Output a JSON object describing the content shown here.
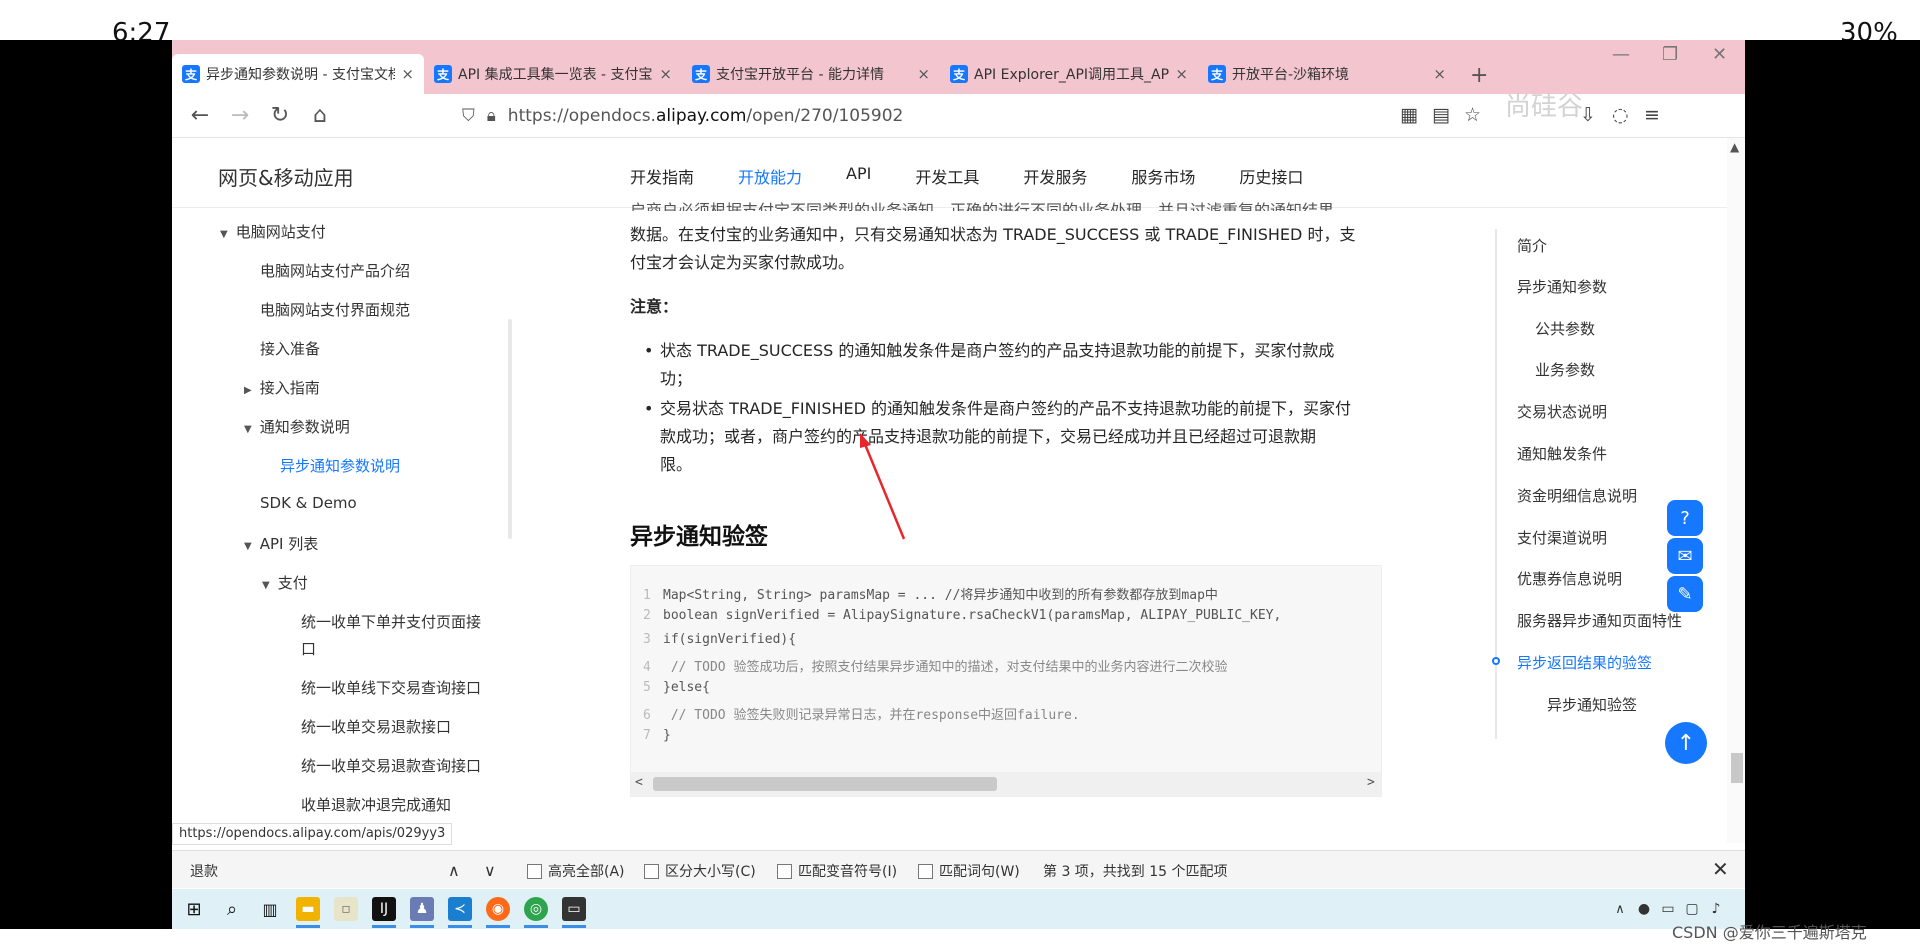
{
  "phone_status": {
    "time": "6:27",
    "battery": "30%"
  },
  "tabs": [
    {
      "label": "异步通知参数说明 - 支付宝文档",
      "close": "×",
      "active": true
    },
    {
      "label": "API 集成工具集一览表 - 支付宝",
      "close": "×",
      "active": false
    },
    {
      "label": "支付宝开放平台 - 能力详情",
      "close": "×",
      "active": false
    },
    {
      "label": "API Explorer_API调用工具_API",
      "close": "×",
      "active": false
    },
    {
      "label": "开放平台-沙箱环境",
      "close": "×",
      "active": false
    }
  ],
  "new_tab": "+",
  "address": {
    "prefix": "https://opendocs.",
    "domain": "alipay.com",
    "path": "/open/270/105902"
  },
  "site": {
    "title": "网页&移动应用",
    "nav": [
      "开发指南",
      "开放能力",
      "API",
      "开发工具",
      "开发服务",
      "服务市场",
      "历史接口"
    ],
    "nav_active": 1
  },
  "sidebar": {
    "items": [
      {
        "label": "电脑网站支付",
        "caret": "▼"
      },
      {
        "label": "电脑网站支付产品介绍"
      },
      {
        "label": "电脑网站支付界面规范"
      },
      {
        "label": "接入准备"
      },
      {
        "label": "接入指南",
        "caret": "▶"
      },
      {
        "label": "通知参数说明",
        "caret": "▼"
      },
      {
        "label": "异步通知参数说明",
        "active": true
      },
      {
        "label": "SDK & Demo"
      },
      {
        "label": "API 列表",
        "caret": "▼"
      },
      {
        "label": "支付",
        "caret": "▼"
      },
      {
        "label": "统一收单下单并支付页面接"
      },
      {
        "label": "口"
      },
      {
        "label": "统一收单线下交易查询接口"
      },
      {
        "label": "统一收单交易退款接口"
      },
      {
        "label": "统一收单交易退款查询接口"
      },
      {
        "label": "收单退款冲退完成通知"
      }
    ]
  },
  "content": {
    "intro_line0": "启商户必须根据支付宝不同类型的业务通知，正确的进行不同的业务处理，并且过滤重复的通知结果",
    "intro_line1": "数据。在支付宝的业务通知中，只有交易通知状态为 TRADE_SUCCESS 或 TRADE_FINISHED 时，支",
    "intro_line2": "付宝才会认定为买家付款成功。",
    "note_title": "注意：",
    "bullet1_line1": "状态 TRADE_SUCCESS 的通知触发条件是商户签约的产品支持退款功能的前提下，买家付款成",
    "bullet1_line2": "功；",
    "bullet2_line1": "交易状态 TRADE_FINISHED 的通知触发条件是商户签约的产品不支持退款功能的前提下，买家付",
    "bullet2_line2": "款成功；或者，商户签约的产品支持退款功能的前提下，交易已经成功并且已经超过可退款期",
    "bullet2_line3": "限。",
    "section_title": "异步通知验签",
    "code": [
      {
        "n": "1",
        "text": "Map<String, String> paramsMap = ... //将异步通知中收到的所有参数都存放到map中"
      },
      {
        "n": "2",
        "text": "boolean signVerified = AlipaySignature.rsaCheckV1(paramsMap, ALIPAY_PUBLIC_KEY,"
      },
      {
        "n": "3",
        "text": "if(signVerified){"
      },
      {
        "n": "4",
        "text": "    // TODO 验签成功后，按照支付结果异步通知中的描述，对支付结果中的业务内容进行二次校验"
      },
      {
        "n": "5",
        "text": "}else{"
      },
      {
        "n": "6",
        "text": "    // TODO 验签失败则记录异常日志，并在response中返回failure."
      },
      {
        "n": "7",
        "text": "}"
      }
    ]
  },
  "toc": [
    {
      "label": "简介"
    },
    {
      "label": "异步通知参数"
    },
    {
      "label": "公共参数",
      "sub": true
    },
    {
      "label": "业务参数",
      "sub": true
    },
    {
      "label": "交易状态说明"
    },
    {
      "label": "通知触发条件"
    },
    {
      "label": "资金明细信息说明"
    },
    {
      "label": "支付渠道说明"
    },
    {
      "label": "优惠券信息说明"
    },
    {
      "label": "服务器异步通知页面特性"
    },
    {
      "label": "异步返回结果的验签",
      "active": true
    },
    {
      "label": "异步通知验签",
      "sub": true
    }
  ],
  "status_url": "https://opendocs.alipay.com/apis/029yy3",
  "findbar": {
    "query": "退款",
    "highlight_all": "高亮全部(A)",
    "match_case": "区分大小写(C)",
    "match_diacritics": "匹配变音符号(I)",
    "whole_words": "匹配词句(W)",
    "result": "第 3 项，共找到 15 个匹配项"
  },
  "csdn_watermark": "CSDN @爱你三千遍斯塔克",
  "overlay_text": "尚硅谷"
}
